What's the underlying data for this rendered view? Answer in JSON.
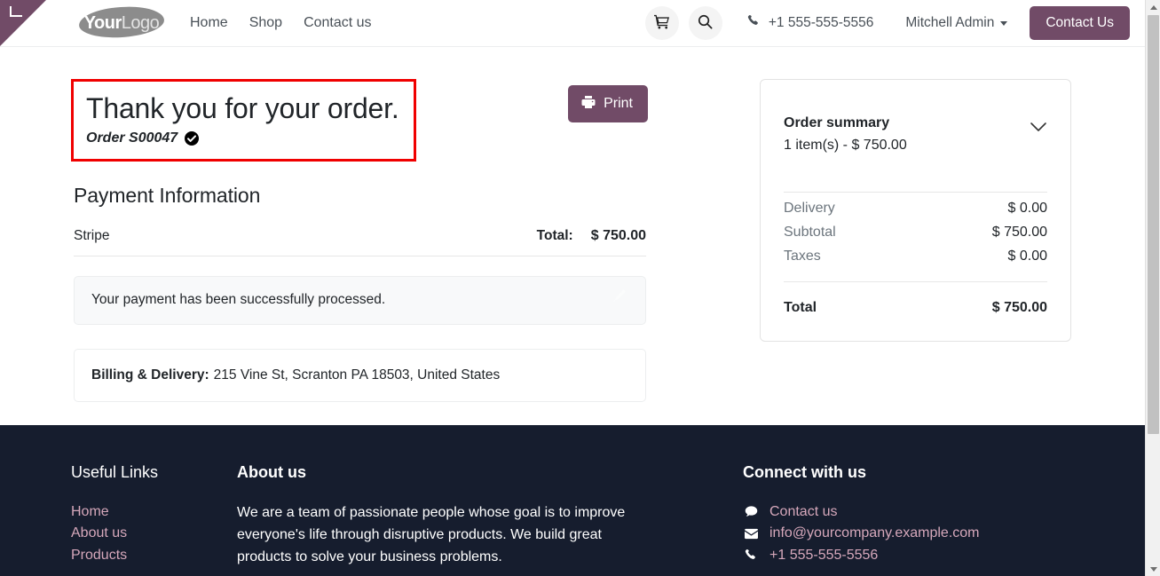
{
  "header": {
    "logo": {
      "bold": "Your",
      "light": "Logo",
      "name": "YourLogo"
    },
    "nav": [
      {
        "label": "Home"
      },
      {
        "label": "Shop"
      },
      {
        "label": "Contact us"
      }
    ],
    "cart_icon": "shopping-cart-icon",
    "search_icon": "search-icon",
    "phone_icon": "phone-icon",
    "phone": "+1 555-555-5556",
    "user": "Mitchell Admin",
    "contact_button": "Contact Us"
  },
  "order": {
    "title": "Thank you for your order.",
    "order_label": "Order S00047",
    "verified_icon": "check-circle-icon",
    "print_button": "Print",
    "print_icon": "printer-icon"
  },
  "payment": {
    "section_title": "Payment Information",
    "provider": "Stripe",
    "total_label": "Total:",
    "total_value": "$ 750.00",
    "success_message": "Your payment has been successfully processed.",
    "edit_icon": "pencil-icon",
    "billing_label": "Billing & Delivery:",
    "billing_address": "215 Vine St, Scranton PA 18503, United States"
  },
  "summary": {
    "title": "Order summary",
    "subtitle": "1 item(s) -  $ 750.00",
    "chevron_icon": "chevron-down-icon",
    "rows": [
      {
        "label": "Delivery",
        "value": "$ 0.00"
      },
      {
        "label": "Subtotal",
        "value": "$ 750.00"
      },
      {
        "label": "Taxes",
        "value": "$ 0.00"
      }
    ],
    "total_label": "Total",
    "total_value": "$ 750.00"
  },
  "footer": {
    "links_title": "Useful Links",
    "links": [
      {
        "label": "Home"
      },
      {
        "label": "About us"
      },
      {
        "label": "Products"
      }
    ],
    "about_title": "About us",
    "about_text": "We are a team of passionate people whose goal is to improve everyone's life through disruptive products. We build great products to solve your business problems.",
    "connect_title": "Connect with us",
    "contacts": [
      {
        "icon": "comment-icon",
        "label": "Contact us"
      },
      {
        "icon": "envelope-icon",
        "label": "info@yourcompany.example.com"
      },
      {
        "icon": "phone-icon",
        "label": "+1 555-555-5556"
      }
    ]
  },
  "colors": {
    "brand_purple": "#714B67",
    "footer_bg": "#161d2e",
    "footer_link": "#d6a8bb",
    "annotation_red": "#f00000"
  }
}
